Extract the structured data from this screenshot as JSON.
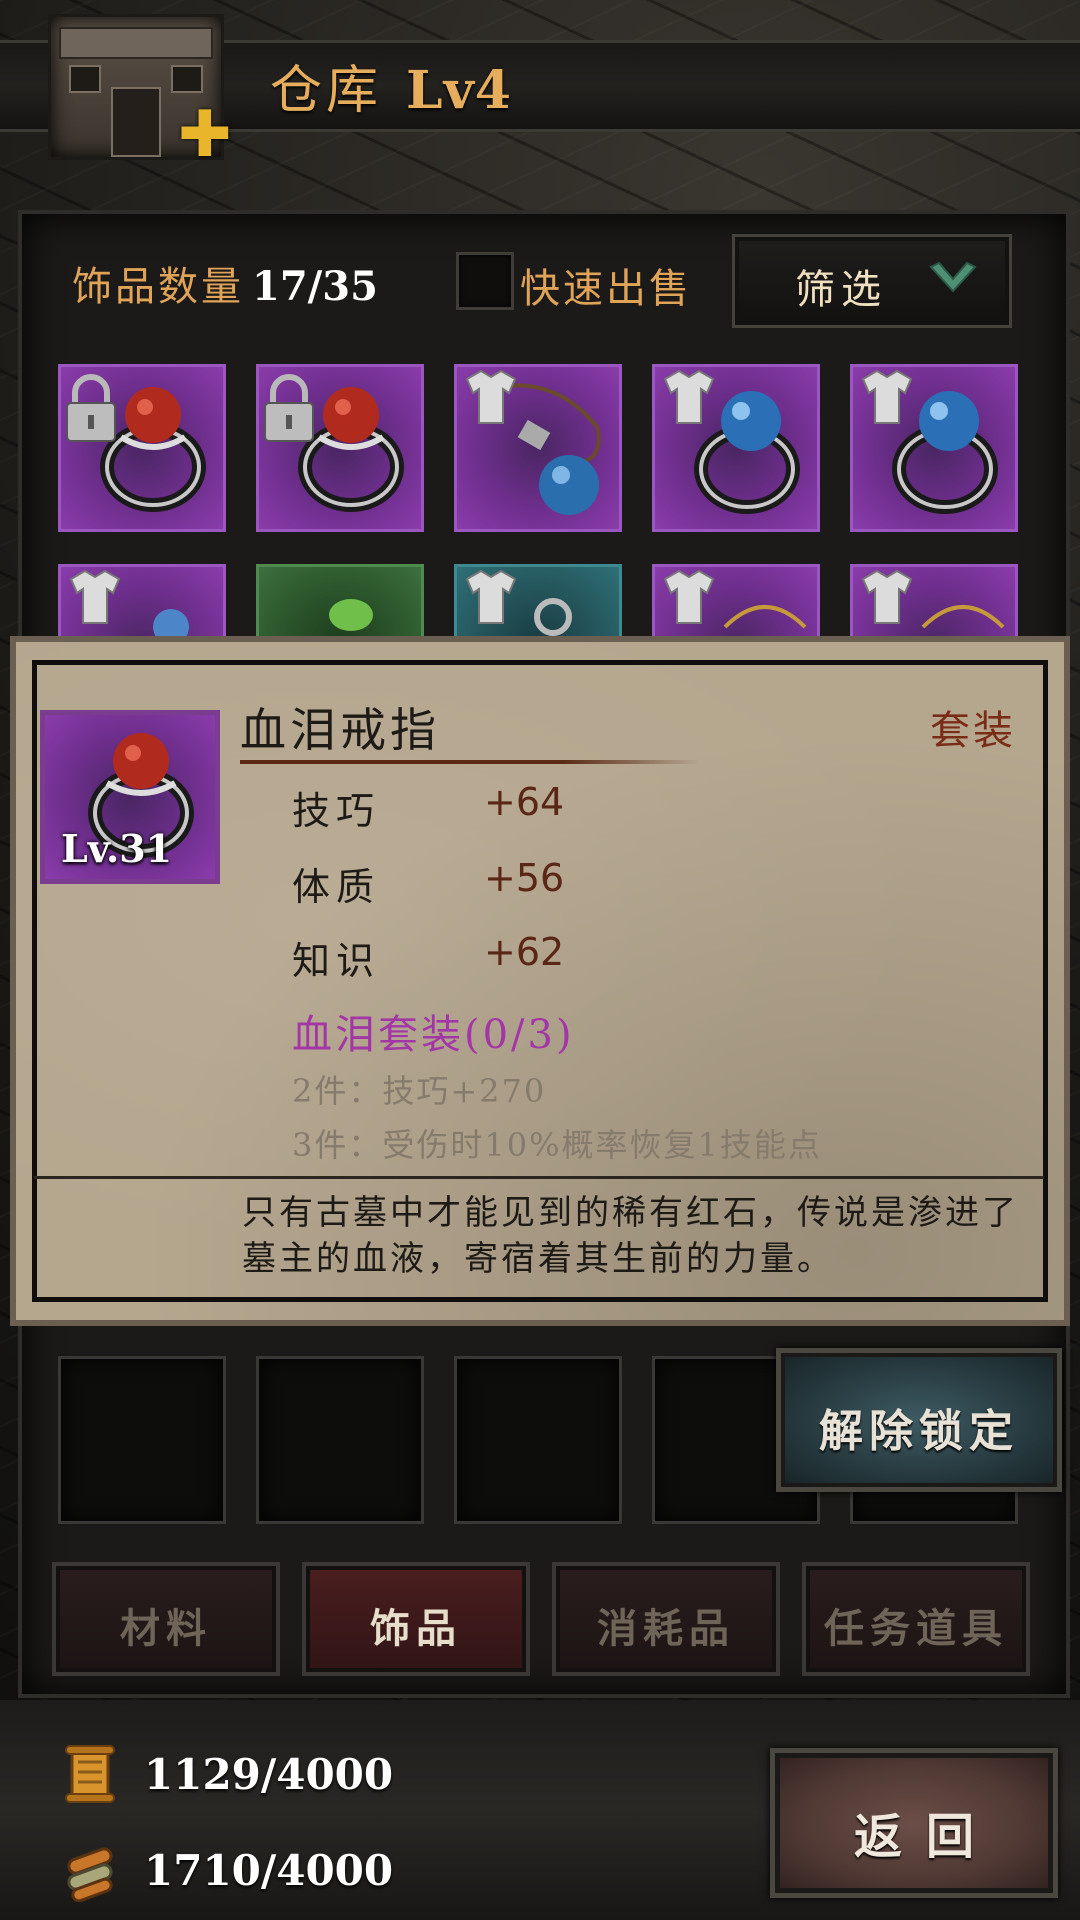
{
  "header": {
    "title": "仓库",
    "level": "Lv4"
  },
  "inventory": {
    "count_label": "饰品数量",
    "count_value": "17/35",
    "quick_sell_label": "快速出售",
    "filter_label": "筛选"
  },
  "detail": {
    "item_name": "血泪戒指",
    "item_level": "Lv.31",
    "set_tag": "套装",
    "stats": [
      {
        "name": "技巧",
        "value": "+64"
      },
      {
        "name": "体质",
        "value": "+56"
      },
      {
        "name": "知识",
        "value": "+62"
      }
    ],
    "set_title": "血泪套装(0/3)",
    "set_bonus_2": "2件：技巧+270",
    "set_bonus_3": "3件：受伤时10%概率恢复1技能点",
    "lore": "只有古墓中才能见到的稀有红石，传说是渗进了墓主的血液，寄宿着其生前的力量。"
  },
  "actions": {
    "unlock_label": "解除锁定",
    "back_label": "返回"
  },
  "tabs": [
    {
      "label": "材料",
      "active": false
    },
    {
      "label": "饰品",
      "active": true
    },
    {
      "label": "消耗品",
      "active": false
    },
    {
      "label": "任务道具",
      "active": false
    }
  ],
  "resources": [
    {
      "icon": "scroll-icon",
      "value": "1129/4000"
    },
    {
      "icon": "scroll-bundle-icon",
      "value": "1710/4000"
    }
  ],
  "colors": {
    "accent": "#e0a458",
    "rarity_purple": "#8a3cab",
    "rarity_green": "#3d7040",
    "rarity_teal": "#2f7078",
    "set_purple": "#a336a6"
  }
}
